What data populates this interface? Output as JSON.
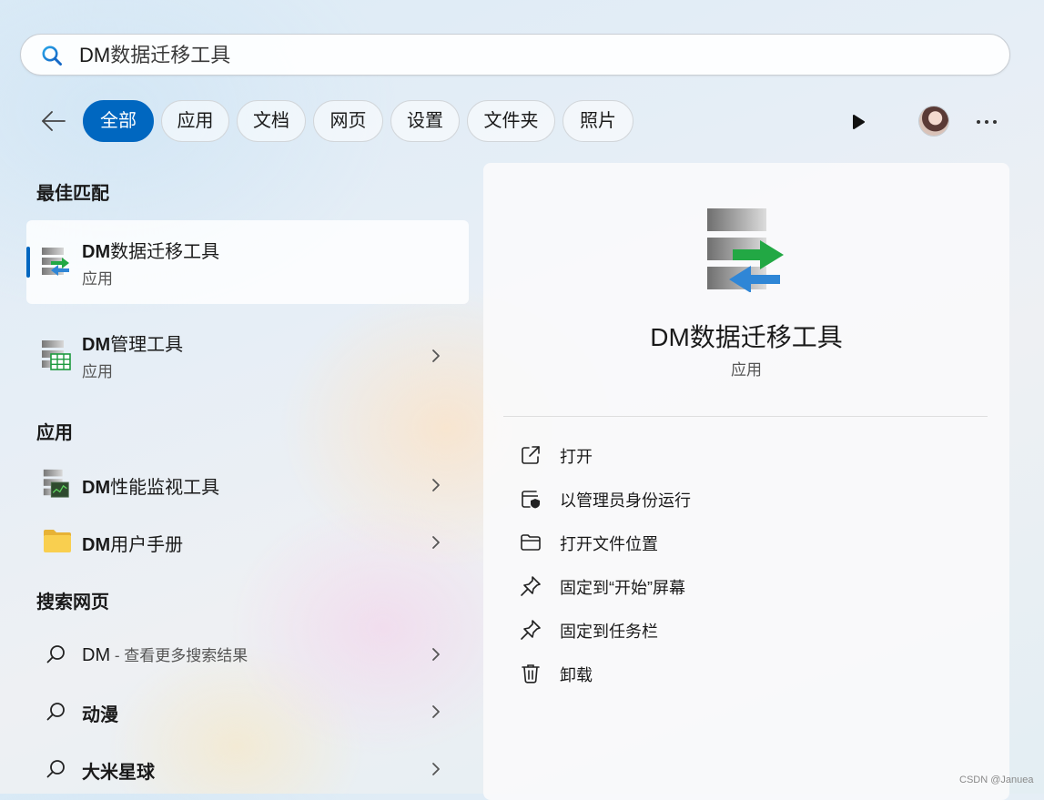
{
  "search": {
    "query_prefix": "DM",
    "query_rest": "数据迁移工具"
  },
  "filters": {
    "items": [
      "全部",
      "应用",
      "文档",
      "网页",
      "设置",
      "文件夹",
      "照片"
    ],
    "active": "全部"
  },
  "sections": {
    "best_match": "最佳匹配",
    "apps": "应用",
    "web": "搜索网页"
  },
  "results": {
    "best": {
      "title_bold": "DM",
      "title_rest": "数据迁移工具",
      "subtitle": "应用"
    },
    "manager": {
      "title_bold": "DM",
      "title_rest": "管理工具",
      "subtitle": "应用"
    },
    "apps": [
      {
        "title_bold": "DM",
        "title_rest": "性能监视工具"
      },
      {
        "title_bold": "DM",
        "title_rest": "用户手册"
      }
    ],
    "web": [
      {
        "title": "DM",
        "suffix": " - 查看更多搜索结果"
      },
      {
        "title": "动漫"
      },
      {
        "title": "大米星球"
      }
    ]
  },
  "detail": {
    "title": "DM数据迁移工具",
    "subtitle": "应用",
    "actions": [
      {
        "label": "打开",
        "icon": "open-external-icon"
      },
      {
        "label": "以管理员身份运行",
        "icon": "shield-admin-icon"
      },
      {
        "label": "打开文件位置",
        "icon": "folder-icon"
      },
      {
        "label": "固定到“开始”屏幕",
        "icon": "pin-icon"
      },
      {
        "label": "固定到任务栏",
        "icon": "pin-icon"
      },
      {
        "label": "卸载",
        "icon": "trash-icon"
      }
    ]
  },
  "colors": {
    "accent": "#0067c0",
    "arrow_green": "#22a844",
    "arrow_blue": "#2f86d6"
  },
  "watermark": "CSDN @Januea"
}
